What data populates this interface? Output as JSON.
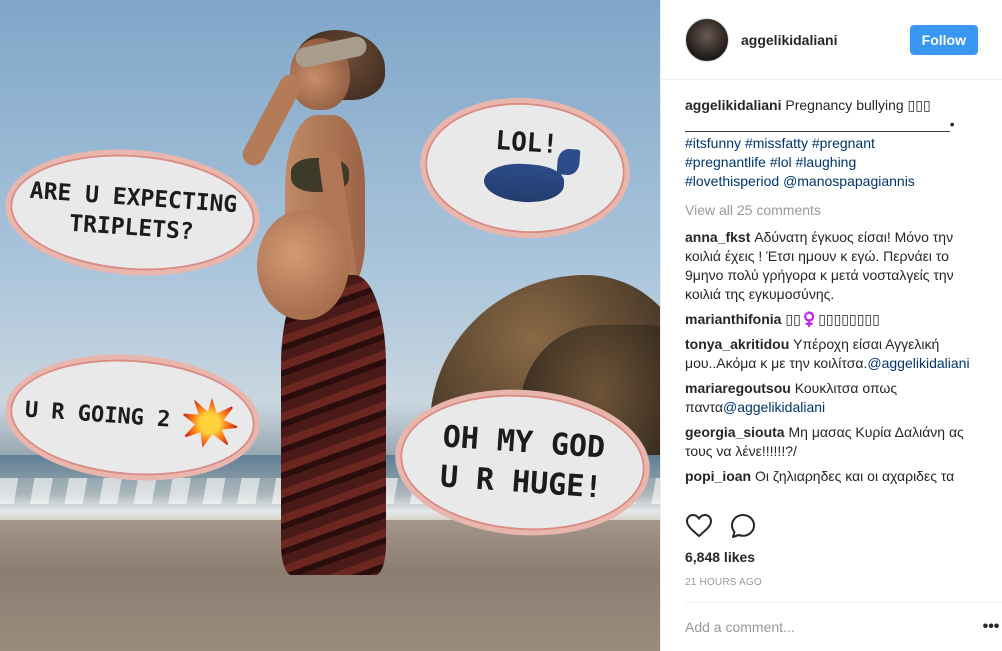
{
  "post": {
    "username": "aggelikidaliani",
    "follow_label": "Follow",
    "image_bubbles": {
      "b1": "ARE U EXPECTING\nTRIPLETS?",
      "b2": "LOL!",
      "b3": "U R GOING 2",
      "b4": "OH MY GOD\nU R HUGE!"
    },
    "caption": {
      "username": "aggelikidaliani",
      "text": "Pregnancy bullying ▯▯▯",
      "divider": "__________________________________•",
      "tags": [
        "#itsfunny",
        "#missfatty",
        "#pregnant",
        "#pregnantlife",
        "#lol",
        "#laughing",
        "#lovethisperiod"
      ],
      "mention": "@manospapagiannis"
    },
    "view_all": "View all 25 comments",
    "comments": [
      {
        "user": "anna_fkst",
        "text": "Αδύνατη έγκυος είσαι! Μόνο την κοιλιά έχεις ! Έτσι ημουν κ εγώ. Περνάει το 9μηνο πολύ γρήγορα κ μετά νοσταλγείς την κοιλιά της εγκυμοσύνης.",
        "mention": ""
      },
      {
        "user": "marianthifonia",
        "text": "▯▯♀️▯▯▯▯▯▯▯▯",
        "mention": ""
      },
      {
        "user": "tonya_akritidou",
        "text": "Υπέροχη είσαι Αγγελική μου..Ακόμα κ με την κοιλίτσα.",
        "mention": "@aggelikidaliani"
      },
      {
        "user": "mariaregoutsou",
        "text": "Κουκλιτσα οπως παντα",
        "mention": "@aggelikidaliani"
      },
      {
        "user": "georgia_siouta",
        "text": "Μη μασας Κυρία Δαλιάνη ας τους να λένε!!!!!!?/",
        "mention": ""
      },
      {
        "user": "popi_ioan",
        "text": "Οι ζηλιαρηδες και οι αχαριδες τα",
        "mention": ""
      }
    ],
    "likes": "6,848 likes",
    "time": "21 HOURS AGO",
    "add_comment_placeholder": "Add a comment...",
    "more_label": "•••"
  },
  "icons": [
    "heart-icon",
    "comment-icon"
  ]
}
